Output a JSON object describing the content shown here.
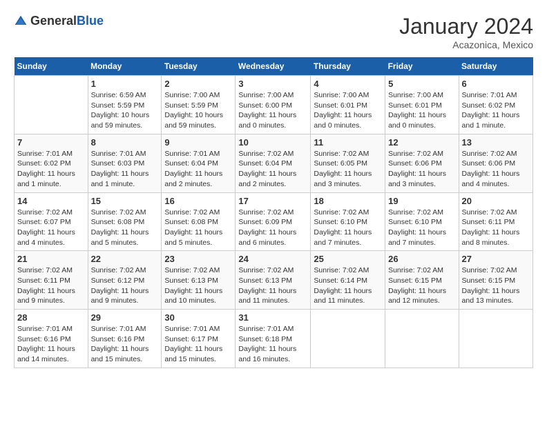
{
  "header": {
    "logo_general": "General",
    "logo_blue": "Blue",
    "month_year": "January 2024",
    "location": "Acazonica, Mexico"
  },
  "days_of_week": [
    "Sunday",
    "Monday",
    "Tuesday",
    "Wednesday",
    "Thursday",
    "Friday",
    "Saturday"
  ],
  "weeks": [
    [
      {
        "day": "",
        "info": ""
      },
      {
        "day": "1",
        "info": "Sunrise: 6:59 AM\nSunset: 5:59 PM\nDaylight: 10 hours\nand 59 minutes."
      },
      {
        "day": "2",
        "info": "Sunrise: 7:00 AM\nSunset: 5:59 PM\nDaylight: 10 hours\nand 59 minutes."
      },
      {
        "day": "3",
        "info": "Sunrise: 7:00 AM\nSunset: 6:00 PM\nDaylight: 11 hours\nand 0 minutes."
      },
      {
        "day": "4",
        "info": "Sunrise: 7:00 AM\nSunset: 6:01 PM\nDaylight: 11 hours\nand 0 minutes."
      },
      {
        "day": "5",
        "info": "Sunrise: 7:00 AM\nSunset: 6:01 PM\nDaylight: 11 hours\nand 0 minutes."
      },
      {
        "day": "6",
        "info": "Sunrise: 7:01 AM\nSunset: 6:02 PM\nDaylight: 11 hours\nand 1 minute."
      }
    ],
    [
      {
        "day": "7",
        "info": "Sunrise: 7:01 AM\nSunset: 6:02 PM\nDaylight: 11 hours\nand 1 minute."
      },
      {
        "day": "8",
        "info": "Sunrise: 7:01 AM\nSunset: 6:03 PM\nDaylight: 11 hours\nand 1 minute."
      },
      {
        "day": "9",
        "info": "Sunrise: 7:01 AM\nSunset: 6:04 PM\nDaylight: 11 hours\nand 2 minutes."
      },
      {
        "day": "10",
        "info": "Sunrise: 7:02 AM\nSunset: 6:04 PM\nDaylight: 11 hours\nand 2 minutes."
      },
      {
        "day": "11",
        "info": "Sunrise: 7:02 AM\nSunset: 6:05 PM\nDaylight: 11 hours\nand 3 minutes."
      },
      {
        "day": "12",
        "info": "Sunrise: 7:02 AM\nSunset: 6:06 PM\nDaylight: 11 hours\nand 3 minutes."
      },
      {
        "day": "13",
        "info": "Sunrise: 7:02 AM\nSunset: 6:06 PM\nDaylight: 11 hours\nand 4 minutes."
      }
    ],
    [
      {
        "day": "14",
        "info": "Sunrise: 7:02 AM\nSunset: 6:07 PM\nDaylight: 11 hours\nand 4 minutes."
      },
      {
        "day": "15",
        "info": "Sunrise: 7:02 AM\nSunset: 6:08 PM\nDaylight: 11 hours\nand 5 minutes."
      },
      {
        "day": "16",
        "info": "Sunrise: 7:02 AM\nSunset: 6:08 PM\nDaylight: 11 hours\nand 5 minutes."
      },
      {
        "day": "17",
        "info": "Sunrise: 7:02 AM\nSunset: 6:09 PM\nDaylight: 11 hours\nand 6 minutes."
      },
      {
        "day": "18",
        "info": "Sunrise: 7:02 AM\nSunset: 6:10 PM\nDaylight: 11 hours\nand 7 minutes."
      },
      {
        "day": "19",
        "info": "Sunrise: 7:02 AM\nSunset: 6:10 PM\nDaylight: 11 hours\nand 7 minutes."
      },
      {
        "day": "20",
        "info": "Sunrise: 7:02 AM\nSunset: 6:11 PM\nDaylight: 11 hours\nand 8 minutes."
      }
    ],
    [
      {
        "day": "21",
        "info": "Sunrise: 7:02 AM\nSunset: 6:11 PM\nDaylight: 11 hours\nand 9 minutes."
      },
      {
        "day": "22",
        "info": "Sunrise: 7:02 AM\nSunset: 6:12 PM\nDaylight: 11 hours\nand 9 minutes."
      },
      {
        "day": "23",
        "info": "Sunrise: 7:02 AM\nSunset: 6:13 PM\nDaylight: 11 hours\nand 10 minutes."
      },
      {
        "day": "24",
        "info": "Sunrise: 7:02 AM\nSunset: 6:13 PM\nDaylight: 11 hours\nand 11 minutes."
      },
      {
        "day": "25",
        "info": "Sunrise: 7:02 AM\nSunset: 6:14 PM\nDaylight: 11 hours\nand 11 minutes."
      },
      {
        "day": "26",
        "info": "Sunrise: 7:02 AM\nSunset: 6:15 PM\nDaylight: 11 hours\nand 12 minutes."
      },
      {
        "day": "27",
        "info": "Sunrise: 7:02 AM\nSunset: 6:15 PM\nDaylight: 11 hours\nand 13 minutes."
      }
    ],
    [
      {
        "day": "28",
        "info": "Sunrise: 7:01 AM\nSunset: 6:16 PM\nDaylight: 11 hours\nand 14 minutes."
      },
      {
        "day": "29",
        "info": "Sunrise: 7:01 AM\nSunset: 6:16 PM\nDaylight: 11 hours\nand 15 minutes."
      },
      {
        "day": "30",
        "info": "Sunrise: 7:01 AM\nSunset: 6:17 PM\nDaylight: 11 hours\nand 15 minutes."
      },
      {
        "day": "31",
        "info": "Sunrise: 7:01 AM\nSunset: 6:18 PM\nDaylight: 11 hours\nand 16 minutes."
      },
      {
        "day": "",
        "info": ""
      },
      {
        "day": "",
        "info": ""
      },
      {
        "day": "",
        "info": ""
      }
    ]
  ]
}
